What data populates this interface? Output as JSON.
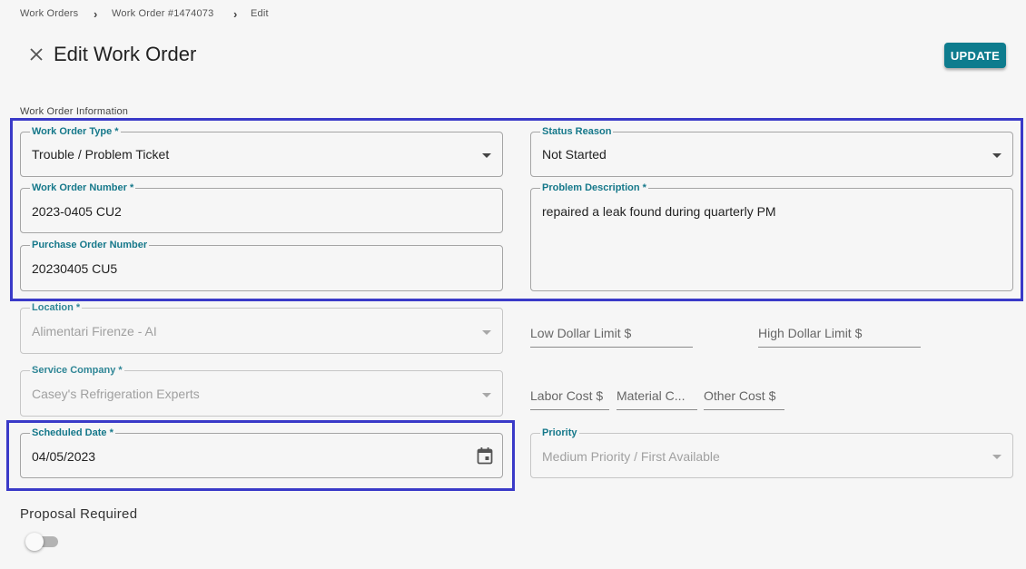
{
  "breadcrumb": {
    "items": [
      "Work Orders",
      "Work Order #1474073",
      "Edit"
    ]
  },
  "header": {
    "title": "Edit Work Order",
    "update_label": "UPDATE",
    "close_icon": "close-icon"
  },
  "section": {
    "label": "Work Order Information"
  },
  "fields": {
    "work_order_type": {
      "label": "Work Order Type *",
      "value": "Trouble / Problem Ticket"
    },
    "status_reason": {
      "label": "Status Reason",
      "value": "Not Started"
    },
    "work_order_number": {
      "label": "Work Order Number *",
      "value": "2023-0405 CU2"
    },
    "problem_description": {
      "label": "Problem Description *",
      "value": "repaired a leak found during quarterly PM"
    },
    "purchase_order_number": {
      "label": "Purchase Order Number",
      "value": "20230405 CU5"
    },
    "location": {
      "label": "Location *",
      "value": "Alimentari Firenze - AI"
    },
    "service_company": {
      "label": "Service Company *",
      "value": "Casey's Refrigeration Experts"
    },
    "scheduled_date": {
      "label": "Scheduled Date *",
      "value": "04/05/2023"
    },
    "priority": {
      "label": "Priority",
      "value": "Medium Priority / First Available"
    }
  },
  "limits": {
    "low_dollar": "Low Dollar Limit $",
    "high_dollar": "High Dollar Limit $"
  },
  "costs": {
    "labor": "Labor Cost $",
    "material": "Material C...",
    "other": "Other Cost $"
  },
  "proposal": {
    "label": "Proposal Required",
    "enabled": false
  },
  "colors": {
    "accent": "#0e7c8e",
    "highlight": "#3a3ac8"
  }
}
